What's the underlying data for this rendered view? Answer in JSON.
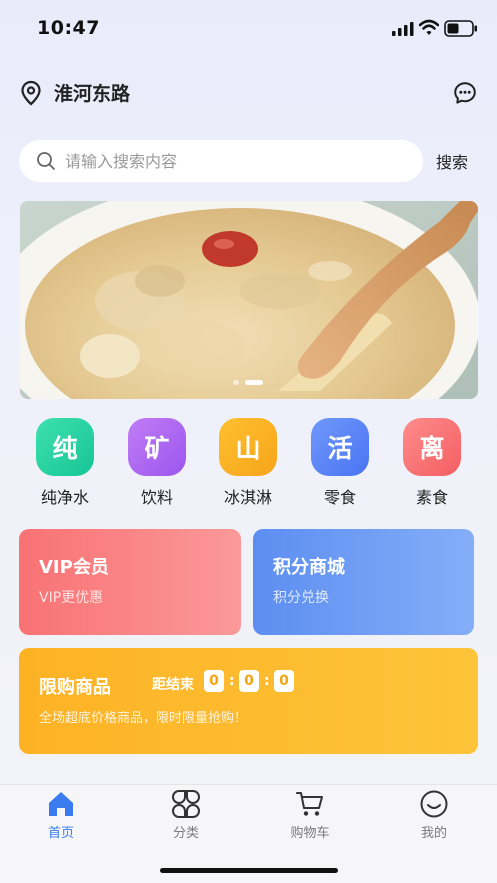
{
  "status_bar": {
    "time": "10:47"
  },
  "header": {
    "location": "淮河东路"
  },
  "search": {
    "placeholder": "请输入搜索内容",
    "button_label": "搜索"
  },
  "banner": {
    "slide_count": 2,
    "active_slide": 2
  },
  "categories": [
    {
      "glyph": "纯",
      "label": "纯净水",
      "color_from": "#3ee0b0",
      "color_to": "#17c596"
    },
    {
      "glyph": "矿",
      "label": "饮料",
      "color_from": "#c07df5",
      "color_to": "#9c55ee"
    },
    {
      "glyph": "山",
      "label": "冰淇淋",
      "color_from": "#fdc02f",
      "color_to": "#f7a41a"
    },
    {
      "glyph": "活",
      "label": "零食",
      "color_from": "#6f98fb",
      "color_to": "#4a74f2"
    },
    {
      "glyph": "离",
      "label": "素食",
      "color_from": "#ff8c8c",
      "color_to": "#f35e62"
    }
  ],
  "promo_cards": [
    {
      "title": "VIP会员",
      "subtitle": "VIP更优惠",
      "color_from": "#f97274",
      "color_to": "#fb9999"
    },
    {
      "title": "积分商城",
      "subtitle": "积分兑换",
      "color_from": "#5c8ef1",
      "color_to": "#85aef8"
    }
  ],
  "flash_sale": {
    "title": "限购商品",
    "countdown_label": "距结束",
    "countdown": [
      "0",
      "0",
      "0"
    ],
    "separator": ":",
    "subtitle": "全场超底价格商品，限时限量抢购！"
  },
  "tab_bar": [
    {
      "label": "首页",
      "icon": "home-icon",
      "active": true
    },
    {
      "label": "分类",
      "icon": "category-icon",
      "active": false
    },
    {
      "label": "购物车",
      "icon": "cart-icon",
      "active": false
    },
    {
      "label": "我的",
      "icon": "profile-icon",
      "active": false
    }
  ],
  "colors": {
    "accent": "#3a7bf0",
    "flash_bg": "#fdb224"
  }
}
